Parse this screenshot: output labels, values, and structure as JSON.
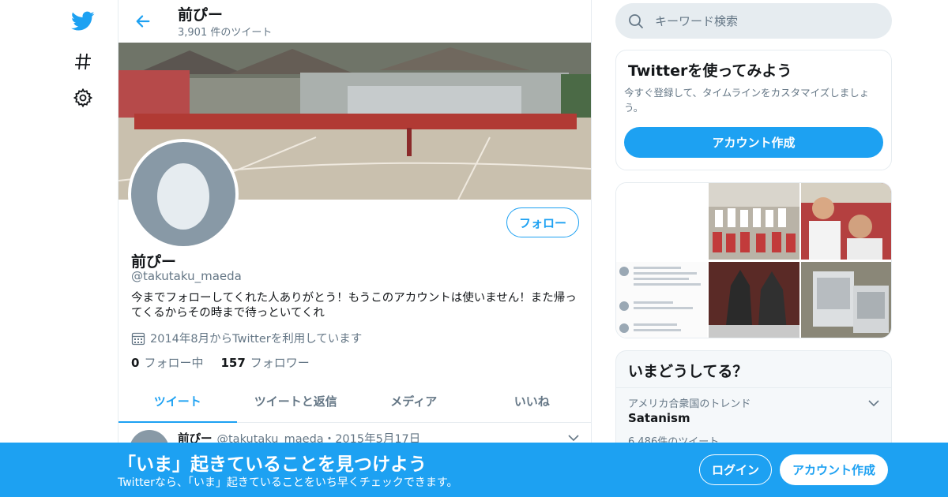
{
  "nav": {
    "icons": [
      "twitter-logo-icon",
      "hashtag-icon",
      "gear-icon"
    ]
  },
  "header": {
    "name": "前ぴー",
    "tweet_count": "3,901 件のツイート"
  },
  "profile": {
    "name": "前ぴー",
    "handle": "@takutaku_maeda",
    "bio": "今までフォローしてくれた人ありがとう！もうこのアカウントは使いません！また帰ってくるからその時まで待っといてくれ",
    "joined": "2014年8月からTwitterを利用しています",
    "following_count": "0",
    "following_label": "フォロー中",
    "followers_count": "157",
    "followers_label": "フォロワー",
    "follow_label": "フォロー"
  },
  "tabs": [
    {
      "label": "ツイート",
      "active": true
    },
    {
      "label": "ツイートと返信",
      "active": false
    },
    {
      "label": "メディア",
      "active": false
    },
    {
      "label": "いいね",
      "active": false
    }
  ],
  "tweet": {
    "name": "前ぴー",
    "meta": "@takutaku_maeda・2015年5月17日"
  },
  "search": {
    "placeholder": "キーワード検索"
  },
  "join_card": {
    "title": "Twitterを使ってみよう",
    "description": "今すぐ登録して、タイムラインをカスタマイズしましょう。",
    "button": "アカウント作成"
  },
  "trends": {
    "title": "いまどうしてる？",
    "location": "アメリカ合衆国のトレンド",
    "name": "Satanism",
    "count": "6,486件のツイート"
  },
  "bottom_bar": {
    "title": "「いま」起きていることを見つけよう",
    "subtitle": "Twitterなら、「いま」起きていることをいち早くチェックできます。",
    "login": "ログイン",
    "signup": "アカウント作成"
  },
  "colors": {
    "accent": "#1da1f2",
    "secondary_text": "#657786",
    "border": "#e6ecf0"
  }
}
